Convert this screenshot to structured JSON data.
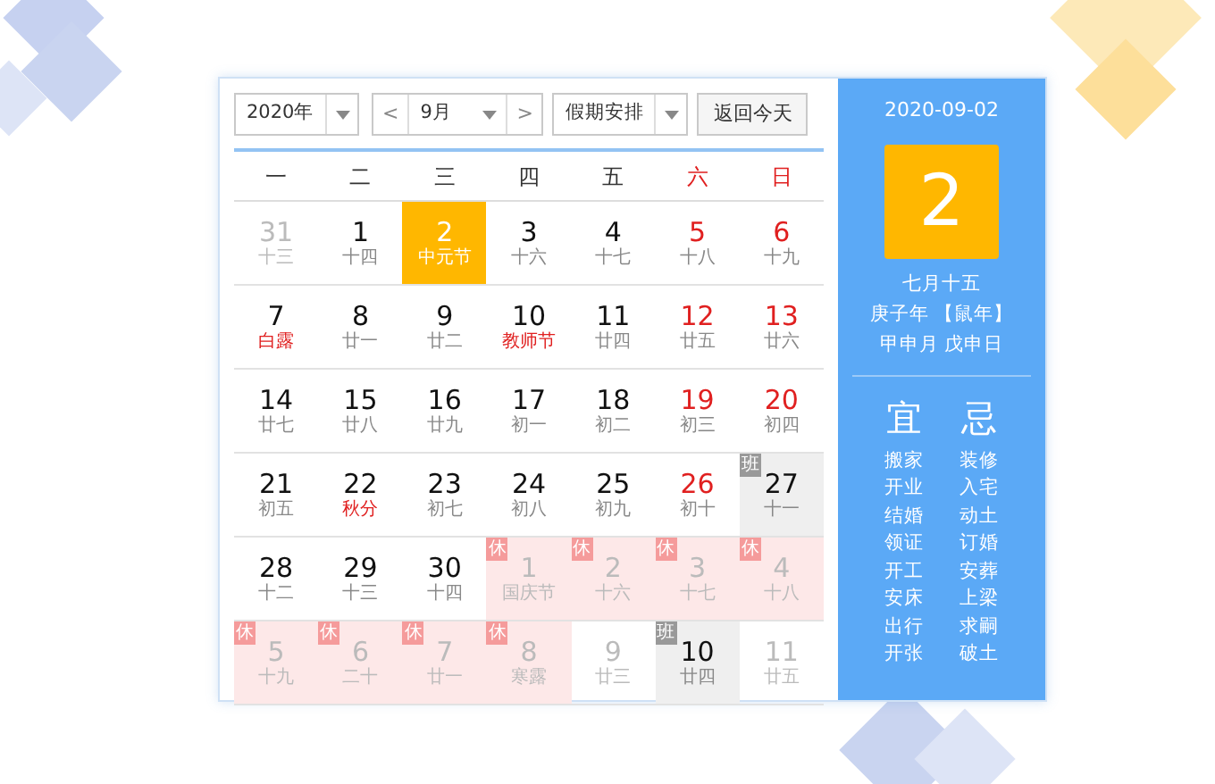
{
  "toolbar": {
    "year": "2020年",
    "prev": "<",
    "month": "9月",
    "next": ">",
    "holiday_select": "假期安排",
    "today_button": "返回今天"
  },
  "weekdays": [
    {
      "label": "一",
      "weekend": false
    },
    {
      "label": "二",
      "weekend": false
    },
    {
      "label": "三",
      "weekend": false
    },
    {
      "label": "四",
      "weekend": false
    },
    {
      "label": "五",
      "weekend": false
    },
    {
      "label": "六",
      "weekend": true
    },
    {
      "label": "日",
      "weekend": true
    }
  ],
  "weeks": [
    [
      {
        "day": "31",
        "sub": "十三",
        "dim": true,
        "weekend": false
      },
      {
        "day": "1",
        "sub": "十四",
        "dim": false,
        "weekend": false
      },
      {
        "day": "2",
        "sub": "中元节",
        "dim": false,
        "weekend": false,
        "selected": true
      },
      {
        "day": "3",
        "sub": "十六",
        "dim": false,
        "weekend": false
      },
      {
        "day": "4",
        "sub": "十七",
        "dim": false,
        "weekend": false
      },
      {
        "day": "5",
        "sub": "十八",
        "dim": false,
        "weekend": true
      },
      {
        "day": "6",
        "sub": "十九",
        "dim": false,
        "weekend": true
      }
    ],
    [
      {
        "day": "7",
        "sub": "白露",
        "dim": false,
        "weekend": false,
        "festival": true
      },
      {
        "day": "8",
        "sub": "廿一",
        "dim": false,
        "weekend": false
      },
      {
        "day": "9",
        "sub": "廿二",
        "dim": false,
        "weekend": false
      },
      {
        "day": "10",
        "sub": "教师节",
        "dim": false,
        "weekend": false,
        "festival": true
      },
      {
        "day": "11",
        "sub": "廿四",
        "dim": false,
        "weekend": false
      },
      {
        "day": "12",
        "sub": "廿五",
        "dim": false,
        "weekend": true
      },
      {
        "day": "13",
        "sub": "廿六",
        "dim": false,
        "weekend": true
      }
    ],
    [
      {
        "day": "14",
        "sub": "廿七",
        "dim": false,
        "weekend": false
      },
      {
        "day": "15",
        "sub": "廿八",
        "dim": false,
        "weekend": false
      },
      {
        "day": "16",
        "sub": "廿九",
        "dim": false,
        "weekend": false
      },
      {
        "day": "17",
        "sub": "初一",
        "dim": false,
        "weekend": false
      },
      {
        "day": "18",
        "sub": "初二",
        "dim": false,
        "weekend": false
      },
      {
        "day": "19",
        "sub": "初三",
        "dim": false,
        "weekend": true
      },
      {
        "day": "20",
        "sub": "初四",
        "dim": false,
        "weekend": true
      }
    ],
    [
      {
        "day": "21",
        "sub": "初五",
        "dim": false,
        "weekend": false
      },
      {
        "day": "22",
        "sub": "秋分",
        "dim": false,
        "weekend": false,
        "festival": true
      },
      {
        "day": "23",
        "sub": "初七",
        "dim": false,
        "weekend": false
      },
      {
        "day": "24",
        "sub": "初八",
        "dim": false,
        "weekend": false
      },
      {
        "day": "25",
        "sub": "初九",
        "dim": false,
        "weekend": false
      },
      {
        "day": "26",
        "sub": "初十",
        "dim": false,
        "weekend": true
      },
      {
        "day": "27",
        "sub": "十一",
        "dim": false,
        "weekend": false,
        "badge": {
          "kind": "work",
          "text": "班"
        }
      }
    ],
    [
      {
        "day": "28",
        "sub": "十二",
        "dim": false,
        "weekend": false
      },
      {
        "day": "29",
        "sub": "十三",
        "dim": false,
        "weekend": false
      },
      {
        "day": "30",
        "sub": "十四",
        "dim": false,
        "weekend": false
      },
      {
        "day": "1",
        "sub": "国庆节",
        "dim": true,
        "weekend": false,
        "badge": {
          "kind": "rest",
          "text": "休"
        }
      },
      {
        "day": "2",
        "sub": "十六",
        "dim": true,
        "weekend": false,
        "badge": {
          "kind": "rest",
          "text": "休"
        }
      },
      {
        "day": "3",
        "sub": "十七",
        "dim": true,
        "weekend": false,
        "badge": {
          "kind": "rest",
          "text": "休"
        }
      },
      {
        "day": "4",
        "sub": "十八",
        "dim": true,
        "weekend": false,
        "badge": {
          "kind": "rest",
          "text": "休"
        }
      }
    ],
    [
      {
        "day": "5",
        "sub": "十九",
        "dim": true,
        "weekend": false,
        "badge": {
          "kind": "rest",
          "text": "休"
        }
      },
      {
        "day": "6",
        "sub": "二十",
        "dim": true,
        "weekend": false,
        "badge": {
          "kind": "rest",
          "text": "休"
        }
      },
      {
        "day": "7",
        "sub": "廿一",
        "dim": true,
        "weekend": false,
        "badge": {
          "kind": "rest",
          "text": "休"
        }
      },
      {
        "day": "8",
        "sub": "寒露",
        "dim": true,
        "weekend": false,
        "badge": {
          "kind": "rest",
          "text": "休"
        }
      },
      {
        "day": "9",
        "sub": "廿三",
        "dim": true,
        "weekend": false
      },
      {
        "day": "10",
        "sub": "廿四",
        "dim": false,
        "weekend": false,
        "badge": {
          "kind": "work",
          "text": "班"
        }
      },
      {
        "day": "11",
        "sub": "廿五",
        "dim": true,
        "weekend": false
      }
    ]
  ],
  "detail": {
    "date": "2020-09-02",
    "big_day": "2",
    "lunar_date": "七月十五",
    "year_info": "庚子年 【鼠年】",
    "ganzhi": "甲申月 戊申日",
    "yi_title": "宜",
    "ji_title": "忌",
    "yi": [
      "搬家",
      "开业",
      "结婚",
      "领证",
      "开工",
      "安床",
      "出行",
      "开张"
    ],
    "ji": [
      "装修",
      "入宅",
      "动土",
      "订婚",
      "安葬",
      "上梁",
      "求嗣",
      "破土"
    ]
  }
}
